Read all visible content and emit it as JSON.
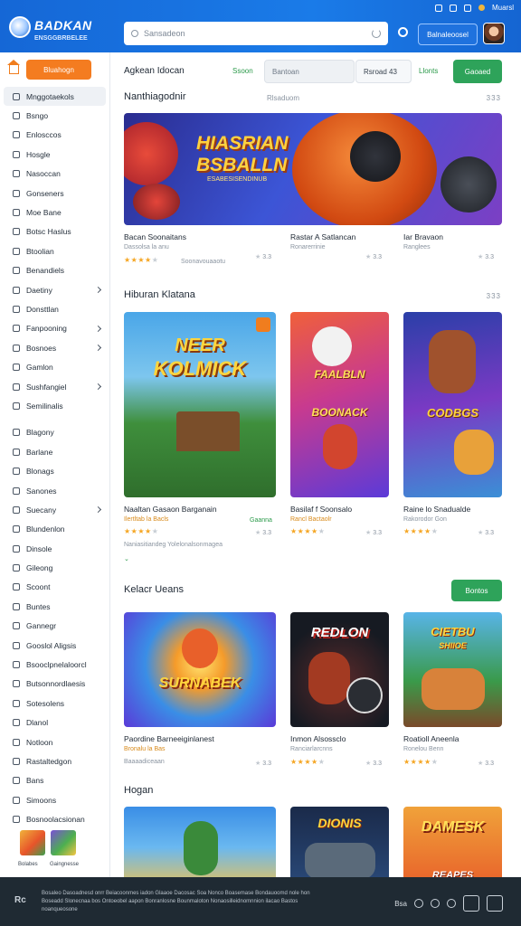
{
  "header": {
    "logo_title": "BADKAN",
    "logo_subtitle": "ENSGGBRBELEE",
    "search_placeholder": "Sansadeon",
    "account_button": "Balnaleoosel",
    "status_label": "Muarsl"
  },
  "sidebar": {
    "home_button": "Bluahogn",
    "items": [
      {
        "label": "Mnggotaekols",
        "active": true,
        "chevron": false
      },
      {
        "label": "Bsngo",
        "chevron": false
      },
      {
        "label": "Enlosccos",
        "chevron": false
      },
      {
        "label": "Hosgle",
        "chevron": false
      },
      {
        "label": "Nasoccan",
        "chevron": false
      },
      {
        "label": "Gonseners",
        "chevron": false
      },
      {
        "label": "Moe Bane",
        "chevron": false
      },
      {
        "label": "Botsc Haslus",
        "chevron": false
      },
      {
        "label": "Btoolian",
        "chevron": false
      },
      {
        "label": "Benandiels",
        "chevron": false
      },
      {
        "label": "Daetiny",
        "chevron": true
      },
      {
        "label": "Donsttlan",
        "chevron": false
      },
      {
        "label": "Fanpooning",
        "chevron": true
      },
      {
        "label": "Bosnoes",
        "chevron": true
      },
      {
        "label": "Gamlon",
        "chevron": false
      },
      {
        "label": "Sushfangiel",
        "chevron": true
      },
      {
        "label": "Semilinalis",
        "chevron": false
      }
    ],
    "items2": [
      {
        "label": "Blagony",
        "chevron": false
      },
      {
        "label": "Barlane",
        "chevron": false
      },
      {
        "label": "Blonags",
        "chevron": false
      },
      {
        "label": "Sanones",
        "chevron": false
      },
      {
        "label": "Suecany",
        "chevron": true
      },
      {
        "label": "Blundenlon",
        "chevron": false
      },
      {
        "label": "Dinsole",
        "chevron": false
      },
      {
        "label": "Gileong",
        "chevron": false
      },
      {
        "label": "Scoont",
        "chevron": false
      },
      {
        "label": "Buntes",
        "chevron": false
      },
      {
        "label": "Gannegr",
        "chevron": false
      },
      {
        "label": "Gooslol Aligsis",
        "chevron": false
      },
      {
        "label": "Bsooclpnelaloorcl",
        "chevron": false
      },
      {
        "label": "Butsonnordlaesis",
        "chevron": false
      },
      {
        "label": "Sotesolens",
        "chevron": false
      },
      {
        "label": "Dlanol",
        "chevron": false
      },
      {
        "label": "Notloon",
        "chevron": false
      },
      {
        "label": "Rastaltedgon",
        "chevron": false
      },
      {
        "label": "Bans",
        "chevron": false
      },
      {
        "label": "Simoons",
        "chevron": false
      },
      {
        "label": "Bosnoolacsionan",
        "chevron": false
      }
    ],
    "thumb_labels": [
      "Bolabes",
      "Gaingnesse"
    ]
  },
  "toolbar": {
    "title": "Agkean Idocan",
    "link": "Ssoon",
    "field": "Bantoan",
    "select": "Rsroad 43",
    "link2": "Llonts",
    "button": "Gaoaed"
  },
  "sections": {
    "s1": {
      "title": "Nanthiagodnir",
      "meta": "Rlsaduom",
      "more": "333",
      "banner": {
        "line1": "HIASRIAN",
        "line2": "BSBALLN",
        "line3": "ESABESISENDINUB"
      },
      "cards": [
        {
          "title": "Bacan Soonaitans",
          "sub": "Dassolsa la anu",
          "stars": 4,
          "note": "Soonavouaaotu"
        },
        {
          "title": "Rastar A Satlancan",
          "sub": "Ronarerrinie",
          "stars": 0,
          "rating": "3.3"
        },
        {
          "title": "Iar Bravaon",
          "sub": "Ranglees",
          "stars": 0,
          "rating": "3.3"
        }
      ]
    },
    "s2": {
      "title": "Hiburan Klatana",
      "more": "333",
      "tiles": [
        {
          "text1": "NEER",
          "text2": "KOLMICK"
        },
        {
          "text1": "FAALBLN",
          "text2": "BOONACK"
        },
        {
          "text1": "CODBGS",
          "text2": ""
        }
      ],
      "cards": [
        {
          "title": "Naaltan Gasaon Barganain",
          "sub": "Ilertltab la Bacls",
          "stars": 4,
          "badge": "Gaanna",
          "rating": "3.3",
          "note": "Naniasitiandeg Yolelonalsonmagea"
        },
        {
          "title": "Basilaf f Soonsalo",
          "sub": "Rancl Bactaolr",
          "stars": 4,
          "rating": "3.3"
        },
        {
          "title": "Raine lo Snadualde",
          "sub": "Rakorodor Gon",
          "stars": 4,
          "rating": "3.3"
        }
      ]
    },
    "s3": {
      "title": "Kelacr Ueans",
      "button": "Bontos",
      "tiles": [
        {
          "text1": "SURNABEK"
        },
        {
          "text1": "REDLON"
        },
        {
          "text1": "CIETBU",
          "text2": "SHIIOE"
        }
      ],
      "cards": [
        {
          "title": "Paordine Barneeiginlanest",
          "sub": "Bronalu la Bas",
          "stars": 0,
          "rating": "3.3",
          "note": "Baaaadiceaan"
        },
        {
          "title": "Inmon Alsossclo",
          "sub": "Ranciarlarcnns",
          "stars": 4,
          "rating": "3.3"
        },
        {
          "title": "Roatioll Aneenla",
          "sub": "Ronelou Benn",
          "stars": 4,
          "rating": "3.3"
        }
      ]
    },
    "s4": {
      "title": "Hogan",
      "tiles": [
        {
          "text1": ""
        },
        {
          "text1": "DIONIS"
        },
        {
          "text1": "DAMESK",
          "text2": "REAPES"
        }
      ]
    }
  },
  "footer": {
    "logo": "Rc",
    "text": "Bosaleo Dasoadnesd onrr Beiacoonmes iadon Glaaoe Dacosac Soa Nonco Boasemase Bondauoomd nole hon Boseadd Slonecnaa bos Ontoeobel aapon Bonranlosne Bounmaloton Nonaosilleidnomnnion ilacao Bastos noanqueosone"
  },
  "colors": {
    "brand_blue": "#1a72e0",
    "accent_orange": "#f47c20",
    "accent_green": "#2ea35a",
    "footer_dark": "#1f2a33"
  }
}
